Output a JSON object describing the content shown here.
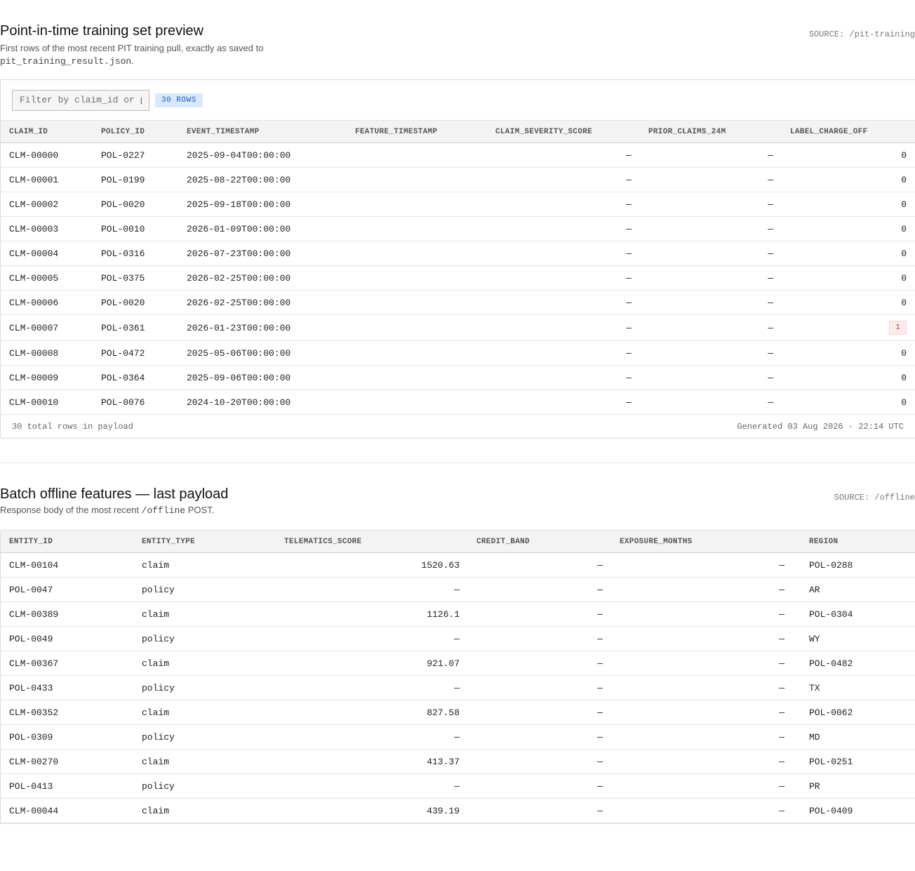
{
  "pit": {
    "title": "Point-in-time training set preview",
    "subtitle_text": "First rows of the most recent PIT training pull, exactly as saved to",
    "subtitle_file": "pit_training_result.json",
    "subtitle_end": ".",
    "source": "SOURCE: /pit-training",
    "filter_placeholder": "Filter by claim_id or policy_id",
    "row_badge": "30 ROWS",
    "columns": [
      "CLAIM_ID",
      "POLICY_ID",
      "EVENT_TIMESTAMP",
      "FEATURE_TIMESTAMP",
      "CLAIM_SEVERITY_SCORE",
      "PRIOR_CLAIMS_24M",
      "LABEL_CHARGE_OFF"
    ],
    "rows": [
      {
        "claim_id": "CLM-00000",
        "policy_id": "POL-0227",
        "event_timestamp": "2025-09-04T00:00:00",
        "feature_timestamp": "",
        "claim_severity_score": "—",
        "prior_claims_24m": "—",
        "label_charge_off": "0"
      },
      {
        "claim_id": "CLM-00001",
        "policy_id": "POL-0199",
        "event_timestamp": "2025-08-22T00:00:00",
        "feature_timestamp": "",
        "claim_severity_score": "—",
        "prior_claims_24m": "—",
        "label_charge_off": "0"
      },
      {
        "claim_id": "CLM-00002",
        "policy_id": "POL-0020",
        "event_timestamp": "2025-09-18T00:00:00",
        "feature_timestamp": "",
        "claim_severity_score": "—",
        "prior_claims_24m": "—",
        "label_charge_off": "0"
      },
      {
        "claim_id": "CLM-00003",
        "policy_id": "POL-0010",
        "event_timestamp": "2026-01-09T00:00:00",
        "feature_timestamp": "",
        "claim_severity_score": "—",
        "prior_claims_24m": "—",
        "label_charge_off": "0"
      },
      {
        "claim_id": "CLM-00004",
        "policy_id": "POL-0316",
        "event_timestamp": "2026-07-23T00:00:00",
        "feature_timestamp": "",
        "claim_severity_score": "—",
        "prior_claims_24m": "—",
        "label_charge_off": "0"
      },
      {
        "claim_id": "CLM-00005",
        "policy_id": "POL-0375",
        "event_timestamp": "2026-02-25T00:00:00",
        "feature_timestamp": "",
        "claim_severity_score": "—",
        "prior_claims_24m": "—",
        "label_charge_off": "0"
      },
      {
        "claim_id": "CLM-00006",
        "policy_id": "POL-0020",
        "event_timestamp": "2026-02-25T00:00:00",
        "feature_timestamp": "",
        "claim_severity_score": "—",
        "prior_claims_24m": "—",
        "label_charge_off": "0"
      },
      {
        "claim_id": "CLM-00007",
        "policy_id": "POL-0361",
        "event_timestamp": "2026-01-23T00:00:00",
        "feature_timestamp": "",
        "claim_severity_score": "—",
        "prior_claims_24m": "—",
        "label_charge_off": "1"
      },
      {
        "claim_id": "CLM-00008",
        "policy_id": "POL-0472",
        "event_timestamp": "2025-05-06T00:00:00",
        "feature_timestamp": "",
        "claim_severity_score": "—",
        "prior_claims_24m": "—",
        "label_charge_off": "0"
      },
      {
        "claim_id": "CLM-00009",
        "policy_id": "POL-0364",
        "event_timestamp": "2025-09-06T00:00:00",
        "feature_timestamp": "",
        "claim_severity_score": "—",
        "prior_claims_24m": "—",
        "label_charge_off": "0"
      },
      {
        "claim_id": "CLM-00010",
        "policy_id": "POL-0076",
        "event_timestamp": "2024-10-20T00:00:00",
        "feature_timestamp": "",
        "claim_severity_score": "—",
        "prior_claims_24m": "—",
        "label_charge_off": "0"
      }
    ],
    "footer_left": "30 total rows in payload",
    "footer_right": "Generated 03 Aug 2026 · 22:14 UTC"
  },
  "offline": {
    "title": "Batch offline features — last payload",
    "subtitle_text": "Response body of the most recent",
    "subtitle_code": "/offline",
    "subtitle_end": "POST.",
    "source": "SOURCE: /offline",
    "columns": [
      "ENTITY_ID",
      "ENTITY_TYPE",
      "TELEMATICS_SCORE",
      "CREDIT_BAND",
      "EXPOSURE_MONTHS",
      "REGION"
    ],
    "rows": [
      {
        "entity_id": "CLM-00104",
        "entity_type": "claim",
        "telematics_score": "1520.63",
        "credit_band": "—",
        "exposure_months": "—",
        "region": "POL-0288"
      },
      {
        "entity_id": "POL-0047",
        "entity_type": "policy",
        "telematics_score": "—",
        "credit_band": "—",
        "exposure_months": "—",
        "region": "AR"
      },
      {
        "entity_id": "CLM-00389",
        "entity_type": "claim",
        "telematics_score": "1126.1",
        "credit_band": "—",
        "exposure_months": "—",
        "region": "POL-0304"
      },
      {
        "entity_id": "POL-0049",
        "entity_type": "policy",
        "telematics_score": "—",
        "credit_band": "—",
        "exposure_months": "—",
        "region": "WY"
      },
      {
        "entity_id": "CLM-00367",
        "entity_type": "claim",
        "telematics_score": "921.07",
        "credit_band": "—",
        "exposure_months": "—",
        "region": "POL-0482"
      },
      {
        "entity_id": "POL-0433",
        "entity_type": "policy",
        "telematics_score": "—",
        "credit_band": "—",
        "exposure_months": "—",
        "region": "TX"
      },
      {
        "entity_id": "CLM-00352",
        "entity_type": "claim",
        "telematics_score": "827.58",
        "credit_band": "—",
        "exposure_months": "—",
        "region": "POL-0062"
      },
      {
        "entity_id": "POL-0309",
        "entity_type": "policy",
        "telematics_score": "—",
        "credit_band": "—",
        "exposure_months": "—",
        "region": "MD"
      },
      {
        "entity_id": "CLM-00270",
        "entity_type": "claim",
        "telematics_score": "413.37",
        "credit_band": "—",
        "exposure_months": "—",
        "region": "POL-0251"
      },
      {
        "entity_id": "POL-0413",
        "entity_type": "policy",
        "telematics_score": "—",
        "credit_band": "—",
        "exposure_months": "—",
        "region": "PR"
      },
      {
        "entity_id": "CLM-00044",
        "entity_type": "claim",
        "telematics_score": "439.19",
        "credit_band": "—",
        "exposure_months": "—",
        "region": "POL-0409"
      }
    ]
  },
  "colors": {
    "accent_badge_bg": "#d9e8fb",
    "accent_badge_text": "#1f5fbf",
    "flag_bg": "#fdeaea",
    "flag_text": "#d23b3b"
  }
}
